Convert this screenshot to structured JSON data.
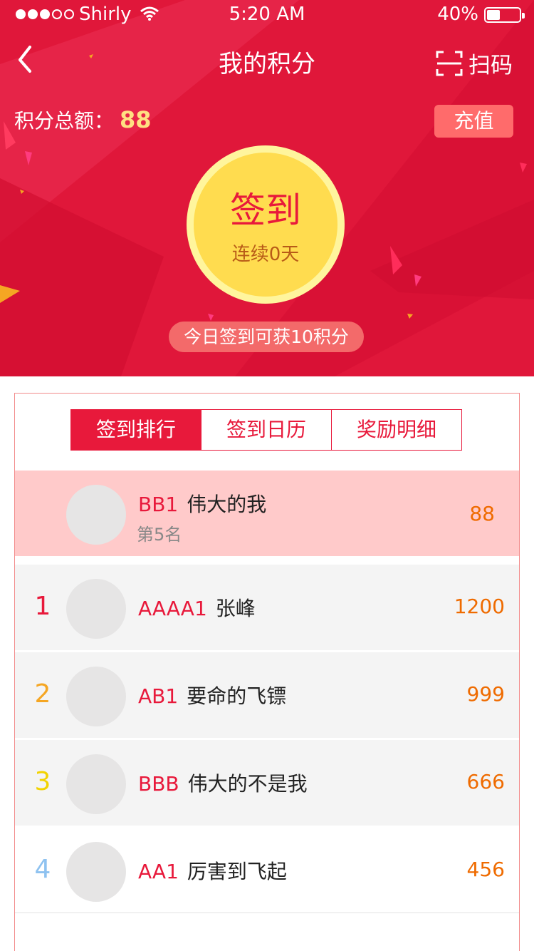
{
  "status_bar": {
    "carrier": "Shirly",
    "time": "5:20 AM",
    "battery": "40%"
  },
  "nav": {
    "title": "我的积分",
    "scan_label": "扫码"
  },
  "points": {
    "label": "积分总额：",
    "value": "88"
  },
  "recharge_label": "充值",
  "signin": {
    "label": "签到",
    "streak": "连续0天"
  },
  "tip": "今日签到可获10积分",
  "tabs": [
    {
      "label": "签到排行",
      "active": true
    },
    {
      "label": "签到日历",
      "active": false
    },
    {
      "label": "奖励明细",
      "active": false
    }
  ],
  "me": {
    "uid": "BB1",
    "nick": "伟大的我",
    "place": "第5名",
    "score": "88"
  },
  "ranking": [
    {
      "rank": "1",
      "uid": "AAAA1",
      "nick": "张峰",
      "score": "1200",
      "rank_color": "#e8193b"
    },
    {
      "rank": "2",
      "uid": "AB1",
      "nick": "要命的飞镖",
      "score": "999",
      "rank_color": "#f5a623"
    },
    {
      "rank": "3",
      "uid": "BBB",
      "nick": "伟大的不是我",
      "score": "666",
      "rank_color": "#f2d300"
    },
    {
      "rank": "4",
      "uid": "AA1",
      "nick": "厉害到飞起",
      "score": "456",
      "rank_color": "#8ec2f0"
    }
  ],
  "colors": {
    "primary": "#e8193b",
    "header_bg": "#e0173a",
    "score": "#ef6b00",
    "signin_yellow": "#ffdc4f"
  }
}
